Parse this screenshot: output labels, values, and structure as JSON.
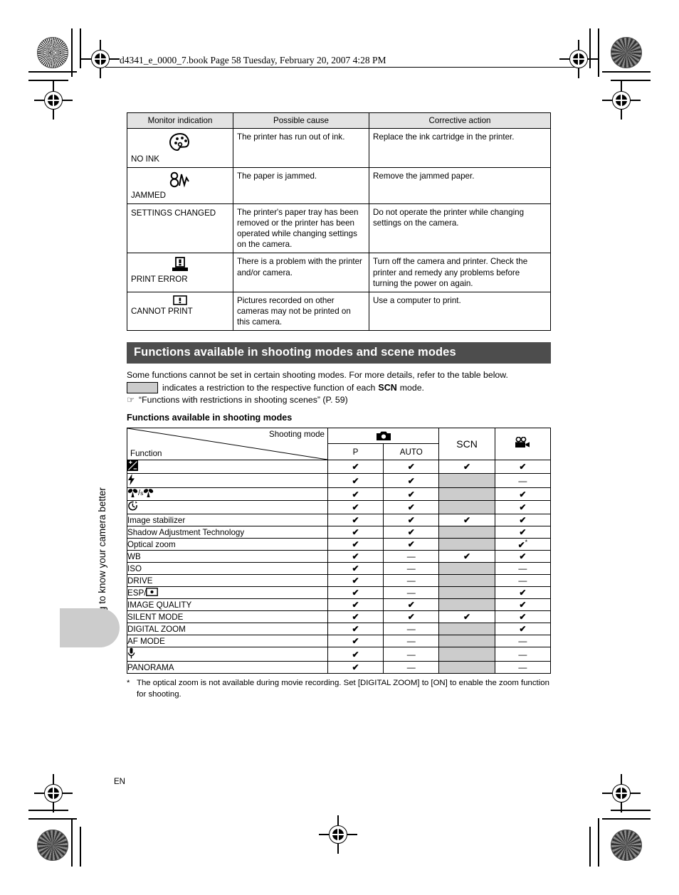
{
  "page_header": "d4341_e_0000_7.book  Page 58  Tuesday, February 20, 2007  4:28 PM",
  "side_tab": {
    "label": "Getting to know your camera better"
  },
  "page_marker": "EN",
  "error_table": {
    "headers": [
      "Monitor indication",
      "Possible cause",
      "Corrective action"
    ],
    "rows": [
      {
        "icon": "no-ink-icon",
        "indication": "NO INK",
        "cause": "The printer has run out of ink.",
        "action": "Replace the ink cartridge in the printer."
      },
      {
        "icon": "paper-jam-icon",
        "indication": "JAMMED",
        "cause": "The paper is jammed.",
        "action": "Remove the jammed paper."
      },
      {
        "icon": "",
        "indication": "SETTINGS CHANGED",
        "cause": "The printer's paper tray has been removed or the printer has been operated while changing settings on the camera.",
        "action": "Do not operate the printer while changing settings on the camera."
      },
      {
        "icon": "print-error-icon",
        "indication": "PRINT ERROR",
        "cause": "There is a problem with the printer and/or camera.",
        "action": "Turn off the camera and printer. Check the printer and remedy any problems before turning the power on again."
      },
      {
        "icon": "cannot-print-icon",
        "indication": "CANNOT PRINT",
        "cause": "Pictures recorded on other cameras may not be printed on this camera.",
        "action": "Use a computer to print."
      }
    ]
  },
  "section": {
    "title": "Functions available in shooting modes and scene modes",
    "intro": "Some functions cannot be set in certain shooting modes. For more details, refer to the table below.",
    "legend_text_before": "indicates a restriction to the respective function of each",
    "legend_scn": "SCN",
    "legend_text_after": "mode.",
    "reference": "“Functions with restrictions in shooting scenes” (P. 59)",
    "subheading": "Functions available in shooting modes"
  },
  "function_table": {
    "corner_shooting_mode": "Shooting mode",
    "corner_function": "Function",
    "group_camera_icon": "still-camera-icon",
    "columns": [
      "P",
      "AUTO",
      "SCN",
      "movie-camera-icon"
    ],
    "scn_label": "SCN",
    "rows": [
      {
        "label": "exposure-compensation-icon",
        "is_icon": true,
        "cells": [
          "check",
          "check",
          "check",
          "check"
        ]
      },
      {
        "label": "flash-icon",
        "is_icon": true,
        "cells": [
          "check",
          "check",
          "gray",
          "dash"
        ]
      },
      {
        "label": "macro-supermacro-icon",
        "is_icon": true,
        "cells": [
          "check",
          "check",
          "gray",
          "check"
        ]
      },
      {
        "label": "self-timer-icon",
        "is_icon": true,
        "cells": [
          "check",
          "check",
          "gray",
          "check"
        ]
      },
      {
        "label": "Image stabilizer",
        "is_icon": false,
        "cells": [
          "check",
          "check",
          "check",
          "check"
        ]
      },
      {
        "label": "Shadow Adjustment Technology",
        "is_icon": false,
        "cells": [
          "check",
          "check",
          "gray",
          "check"
        ]
      },
      {
        "label": "Optical zoom",
        "is_icon": false,
        "cells": [
          "check",
          "check",
          "gray",
          "check-star"
        ]
      },
      {
        "label": "WB",
        "is_icon": false,
        "cells": [
          "check",
          "dash",
          "check",
          "check"
        ]
      },
      {
        "label": "ISO",
        "is_icon": false,
        "cells": [
          "check",
          "dash",
          "gray",
          "dash"
        ]
      },
      {
        "label": "DRIVE",
        "is_icon": false,
        "cells": [
          "check",
          "dash",
          "gray",
          "dash"
        ]
      },
      {
        "label": "ESP/spot-metering-icon",
        "is_icon": false,
        "cells": [
          "check",
          "dash",
          "gray",
          "check"
        ]
      },
      {
        "label": "IMAGE QUALITY",
        "is_icon": false,
        "cells": [
          "check",
          "check",
          "gray",
          "check"
        ]
      },
      {
        "label": "SILENT MODE",
        "is_icon": false,
        "cells": [
          "check",
          "check",
          "check",
          "check"
        ]
      },
      {
        "label": "DIGITAL ZOOM",
        "is_icon": false,
        "cells": [
          "check",
          "dash",
          "gray",
          "check"
        ]
      },
      {
        "label": "AF MODE",
        "is_icon": false,
        "cells": [
          "check",
          "dash",
          "gray",
          "dash"
        ]
      },
      {
        "label": "microphone-icon",
        "is_icon": true,
        "cells": [
          "check",
          "dash",
          "gray",
          "dash"
        ]
      },
      {
        "label": "PANORAMA",
        "is_icon": false,
        "cells": [
          "check",
          "dash",
          "gray",
          "dash"
        ]
      }
    ],
    "footnote_marker": "*",
    "footnote": "The optical zoom is not available during movie recording. Set [DIGITAL ZOOM] to [ON] to enable the zoom function for shooting."
  },
  "glyphs": {
    "check": "✔",
    "dash": "—",
    "hand": "☞"
  },
  "colors": {
    "section_bar": "#4d4d4d",
    "header_fill": "#e3e3e3",
    "restriction_gray": "#cccccc",
    "tab_gray": "#cccccc"
  }
}
